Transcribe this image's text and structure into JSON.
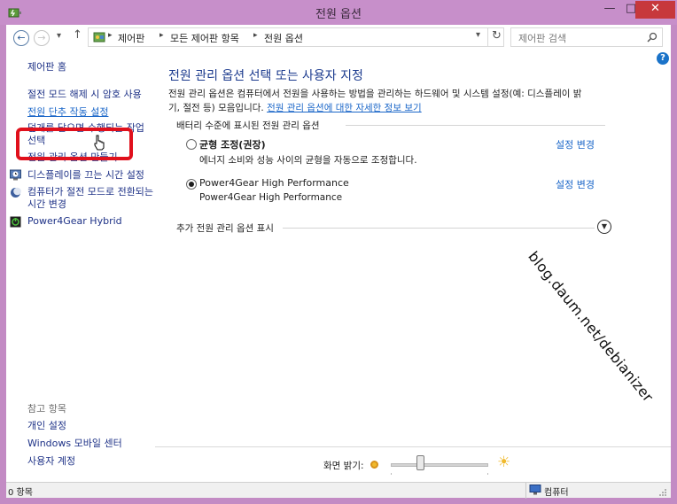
{
  "window": {
    "title": "전원 옵션",
    "controls": {
      "minimize": "—",
      "maximize": "□",
      "close": "✕"
    }
  },
  "nav": {
    "back_icon": "arrow-left-icon",
    "forward_icon": "arrow-right-icon",
    "recent_icon": "chevron-down-icon",
    "up_icon": "arrow-up-icon",
    "breadcrumb": [
      "제어판",
      "모든 제어판 항목",
      "전원 옵션"
    ],
    "refresh_icon": "refresh-icon",
    "search_placeholder": "제어판 검색"
  },
  "sidebar": {
    "home": "제어판 홈",
    "items": [
      {
        "label": "절전 모드 해제 시 암호 사용",
        "icon": null
      },
      {
        "label": "전원 단추 작동 설정",
        "icon": null
      },
      {
        "label_line1": "덮개를 닫으면 수행되는 작업",
        "label_line2": "선택",
        "icon": null
      },
      {
        "label": "전원 관리 옵션 만들기",
        "icon": null
      },
      {
        "label": "디스플레이를 끄는 시간 설정",
        "icon": "display-clock-icon"
      },
      {
        "label_line1": "컴퓨터가 절전 모드로 전환되는",
        "label_line2": "시간 변경",
        "icon": "moon-icon"
      },
      {
        "label": "Power4Gear Hybrid",
        "icon": "power4gear-icon"
      }
    ],
    "see_also_title": "참고 항목",
    "see_also": [
      "개인 설정",
      "Windows 모바일 센터",
      "사용자 계정"
    ]
  },
  "main": {
    "heading": "전원 관리 옵션 선택 또는 사용자 지정",
    "description_line1": "전원 관리 옵션은 컴퓨터에서 전원을 사용하는 방법을 관리하는 하드웨어 및 시스템 설정(예: 디스플레이 밝",
    "description_line2_prefix": "기, 절전 등) 모음입니다. ",
    "description_link": "전원 관리 옵션에 대한 자세한 정보 보기",
    "battery_section": "배터리 수준에 표시된 전원 관리 옵션",
    "plans": [
      {
        "name": "균형 조정(권장)",
        "desc": "에너지 소비와 성능 사이의 균형을 자동으로 조정합니다.",
        "link": "설정 변경",
        "selected": false
      },
      {
        "name": "Power4Gear High Performance",
        "desc": "Power4Gear High Performance",
        "link": "설정 변경",
        "selected": true
      }
    ],
    "more_plans": "추가 전원 관리 옵션 표시"
  },
  "watermark": "blog.daum.net/debianizer",
  "brightness": {
    "label": "화면 밝기:",
    "level": 0.3
  },
  "status": {
    "items": "0 항목",
    "computer": "컴퓨터"
  },
  "colors": {
    "highlight": "#e0101c",
    "link": "#1a66c8",
    "title_bar": "#c78fca",
    "close": "#c7383c"
  }
}
